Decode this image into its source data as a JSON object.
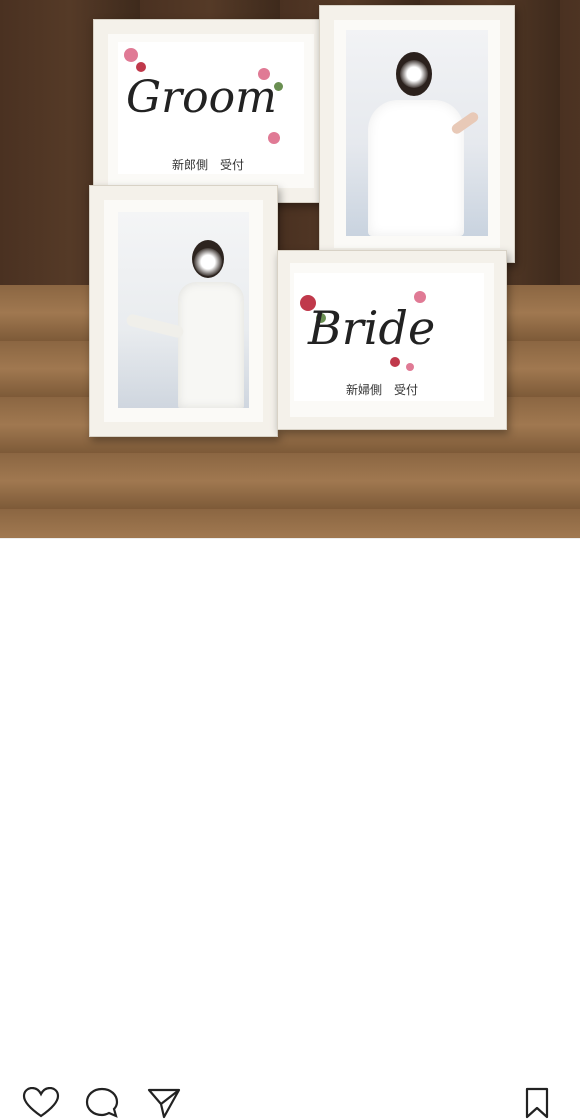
{
  "groom_card": {
    "title": "Groom",
    "caption": "新郎側　受付"
  },
  "bride_card": {
    "title": "Bride",
    "caption": "新婦側　受付"
  },
  "action_bar": {
    "icons": [
      "heart-icon",
      "comment-icon",
      "share-icon",
      "bookmark-icon"
    ]
  },
  "colors": {
    "frame": "#f4f1ea",
    "wall": "#4a3121",
    "floor": "#9c7448",
    "flower_pink": "#e07a95",
    "flower_red": "#c0394b",
    "leaf_green": "#6a8f52"
  }
}
